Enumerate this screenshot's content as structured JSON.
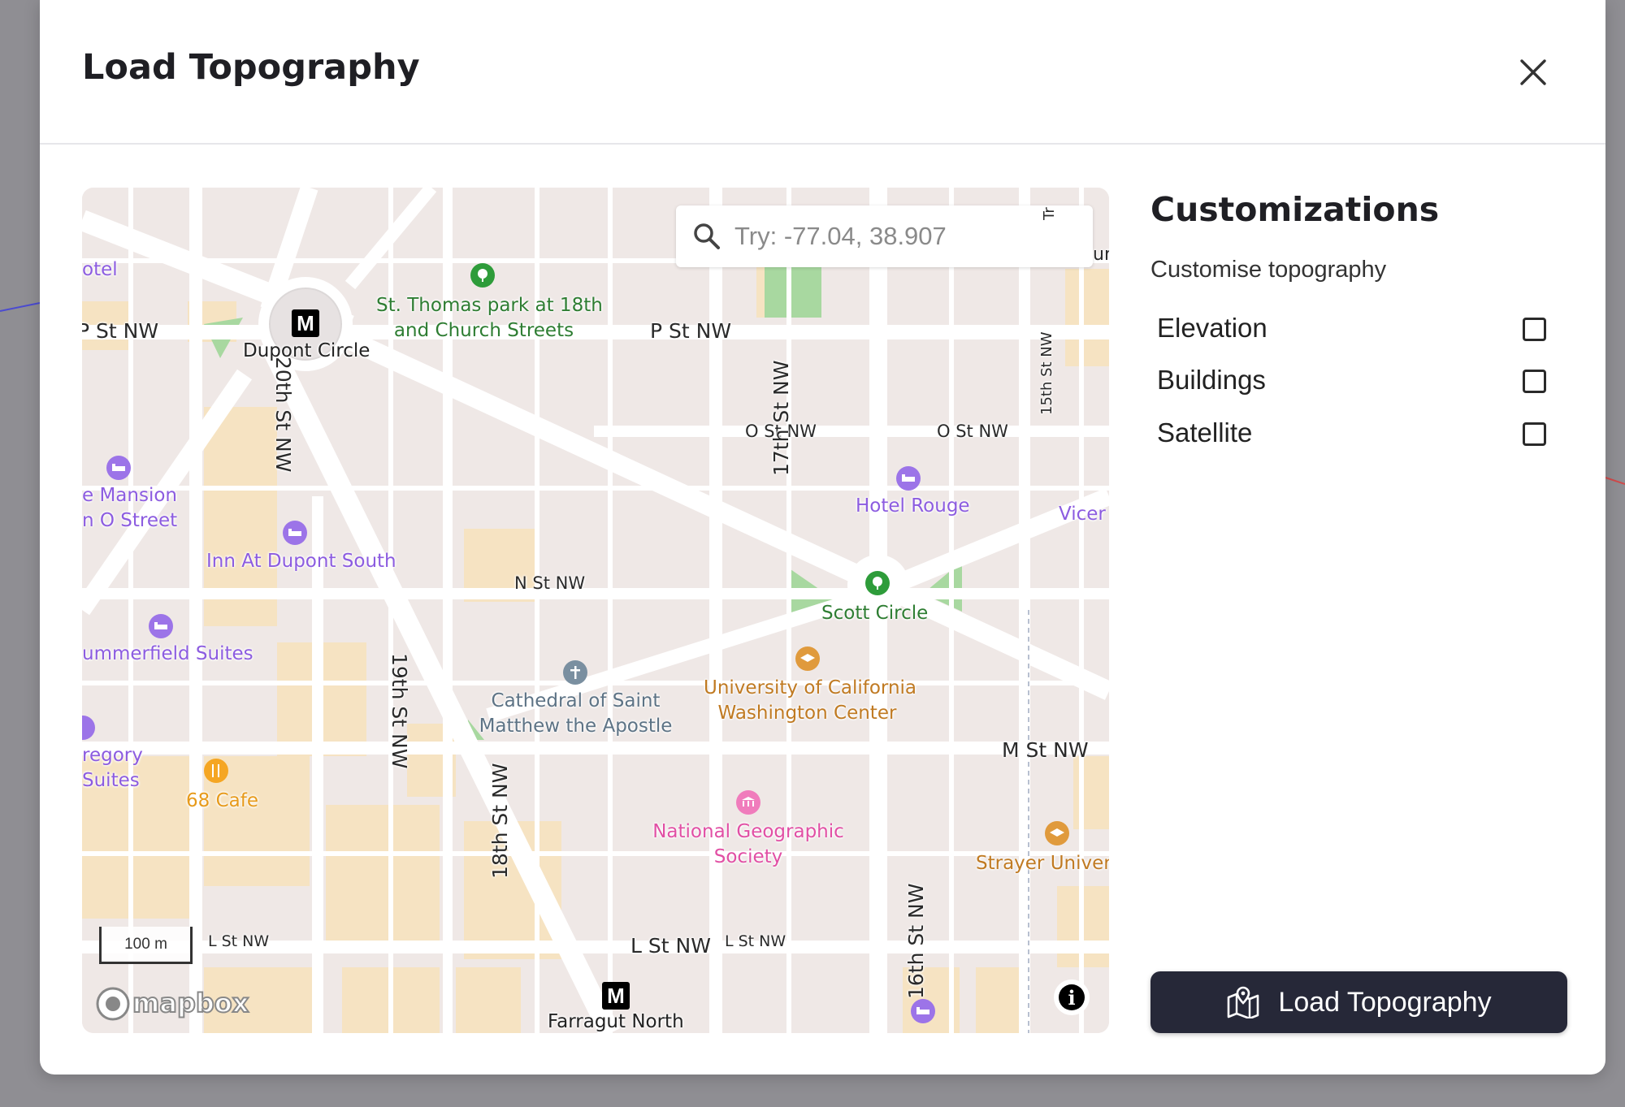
{
  "modal": {
    "title": "Load Topography",
    "close_icon": "close-icon"
  },
  "map": {
    "search": {
      "placeholder": "Try: -77.04, 38.907",
      "icon": "search-icon"
    },
    "streets": {
      "p_st_left": "P St NW",
      "p_st_mid": "P St NW",
      "o_st_1": "O St NW",
      "o_st_2": "O St NW",
      "n_st": "N St NW",
      "m_st": "M St NW",
      "l_st_left": "L St NW",
      "l_st_mid": "L St NW",
      "l_st_right": "L St NW",
      "st_20th": "20th St NW",
      "st_19th": "19th St NW",
      "st_18th": "18th St NW",
      "st_17th": "17th St NW",
      "st_16th": "16th St NW",
      "st_15th": "15th St NW",
      "top_right_partial": "Tr",
      "top_right_edge": "ur"
    },
    "places": {
      "dupont_circle": "Dupont Circle",
      "st_thomas_1": "St. Thomas park at 18th",
      "st_thomas_2": "and Church Streets",
      "hotel_partial": "otel",
      "mansion_1": "e Mansion",
      "mansion_2": "n O Street",
      "inn_dupont": "Inn At Dupont South",
      "summerfield": "ummerfield Suites",
      "gregory_1": "regory",
      "gregory_2": "Suites",
      "cafe_68": "68 Cafe",
      "hotel_rouge": "Hotel Rouge",
      "viceroy": "Vicer",
      "scott_circle": "Scott Circle",
      "cathedral_1": "Cathedral of Saint",
      "cathedral_2": "Matthew the Apostle",
      "uc_1": "University of California",
      "uc_2": "Washington Center",
      "ngs_1": "National Geographic",
      "ngs_2": "Society",
      "strayer": "Strayer Univers",
      "farragut": "Farragut North"
    },
    "metro_label": "M",
    "scale": "100 m",
    "attribution": "mapbox",
    "info_label": "i"
  },
  "side": {
    "title": "Customizations",
    "subtitle": "Customise topography",
    "options": [
      {
        "label": "Elevation",
        "checked": false
      },
      {
        "label": "Buildings",
        "checked": false
      },
      {
        "label": "Satellite",
        "checked": false
      }
    ],
    "load_button": {
      "label": "Load Topography",
      "icon": "map-pin-icon"
    }
  }
}
